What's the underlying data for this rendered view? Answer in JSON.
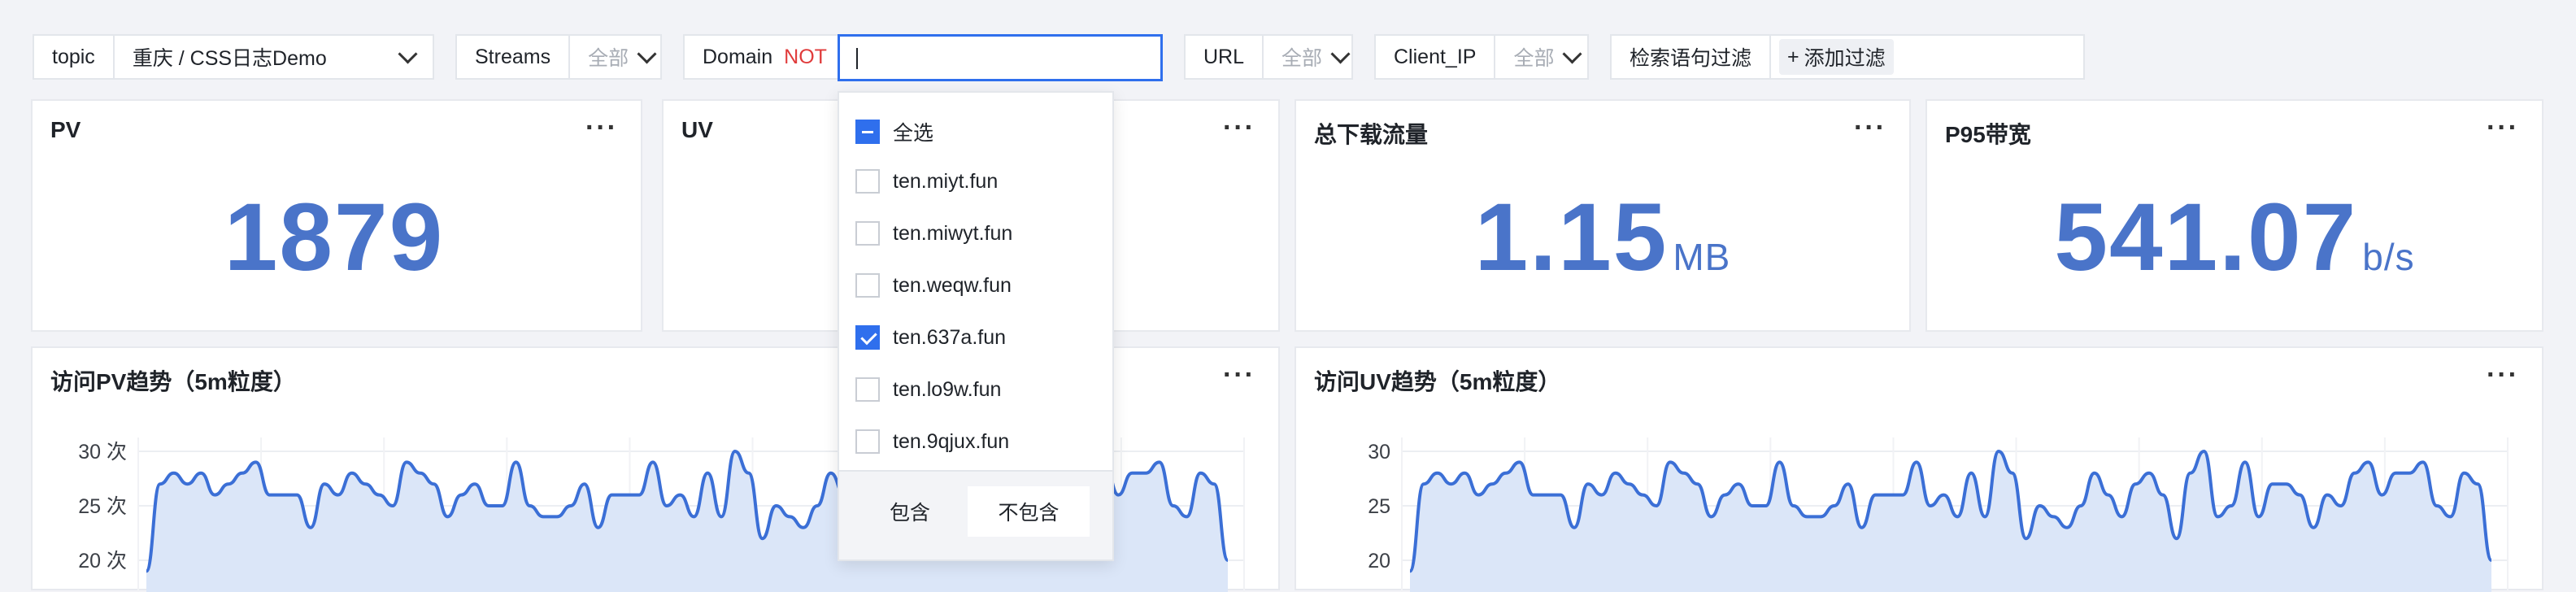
{
  "filters": {
    "topic": {
      "label": "topic",
      "value": "重庆 / CSS日志Demo"
    },
    "streams": {
      "label": "Streams",
      "value": "全部"
    },
    "domain": {
      "label": "Domain",
      "not": "NOT",
      "value": ""
    },
    "url": {
      "label": "URL",
      "value": "全部"
    },
    "client_ip": {
      "label": "Client_IP",
      "value": "全部"
    },
    "query": {
      "label": "检索语句过滤",
      "add": "添加过滤"
    }
  },
  "cards": {
    "pv": {
      "title": "PV",
      "value": "1879",
      "unit": ""
    },
    "uv": {
      "title": "UV"
    },
    "download": {
      "title": "总下载流量",
      "value": "1.15",
      "unit": "MB"
    },
    "p95": {
      "title": "P95带宽",
      "value": "541.07",
      "unit": "b/s"
    },
    "more": "···"
  },
  "dropdown": {
    "select_all": "全选",
    "options": [
      {
        "label": "ten.miyt.fun",
        "checked": false
      },
      {
        "label": "ten.miwyt.fun",
        "checked": false
      },
      {
        "label": "ten.weqw.fun",
        "checked": false
      },
      {
        "label": "ten.637a.fun",
        "checked": true
      },
      {
        "label": "ten.lo9w.fun",
        "checked": false
      },
      {
        "label": "ten.9qjux.fun",
        "checked": false
      }
    ],
    "include": "包含",
    "exclude": "不包含"
  },
  "chart_data": [
    {
      "type": "area",
      "title": "访问PV趋势（5m粒度）",
      "y_ticks": [
        "30 次",
        "25 次",
        "20 次"
      ],
      "ylim": [
        18,
        31
      ],
      "values": [
        19,
        27,
        28,
        27,
        28,
        26,
        27,
        28,
        29,
        26,
        26,
        26,
        23,
        27,
        26,
        28,
        27,
        26,
        25,
        29,
        28,
        27,
        24,
        26,
        27,
        25,
        25,
        29,
        25,
        24,
        24,
        25,
        27,
        23,
        26,
        26,
        26,
        29,
        25,
        26,
        24,
        28,
        24,
        30,
        28,
        22,
        25,
        24,
        23,
        25,
        28,
        26,
        24,
        27,
        28,
        26,
        22,
        28,
        30,
        24,
        25,
        29,
        24,
        27,
        27,
        26,
        23,
        26,
        25,
        28,
        29,
        26,
        28,
        28,
        29,
        25,
        24,
        28,
        27,
        20
      ]
    },
    {
      "type": "area",
      "title": "访问UV趋势（5m粒度）",
      "y_ticks": [
        "30",
        "25",
        "20"
      ],
      "ylim": [
        18,
        31
      ],
      "values": [
        19,
        27,
        28,
        27,
        28,
        26,
        27,
        28,
        29,
        26,
        26,
        26,
        23,
        27,
        26,
        28,
        27,
        26,
        25,
        29,
        28,
        27,
        24,
        26,
        27,
        25,
        25,
        29,
        25,
        24,
        24,
        25,
        27,
        23,
        26,
        26,
        26,
        29,
        25,
        26,
        24,
        28,
        24,
        30,
        28,
        22,
        25,
        24,
        23,
        25,
        28,
        26,
        24,
        27,
        28,
        26,
        22,
        28,
        30,
        24,
        25,
        29,
        24,
        27,
        27,
        26,
        23,
        26,
        25,
        28,
        29,
        26,
        28,
        28,
        29,
        25,
        24,
        28,
        27,
        20
      ]
    }
  ],
  "colors": {
    "accent": "#2f6fed",
    "number": "#4a74c9",
    "line": "#3b6fd6",
    "not": "#e03b3b"
  }
}
